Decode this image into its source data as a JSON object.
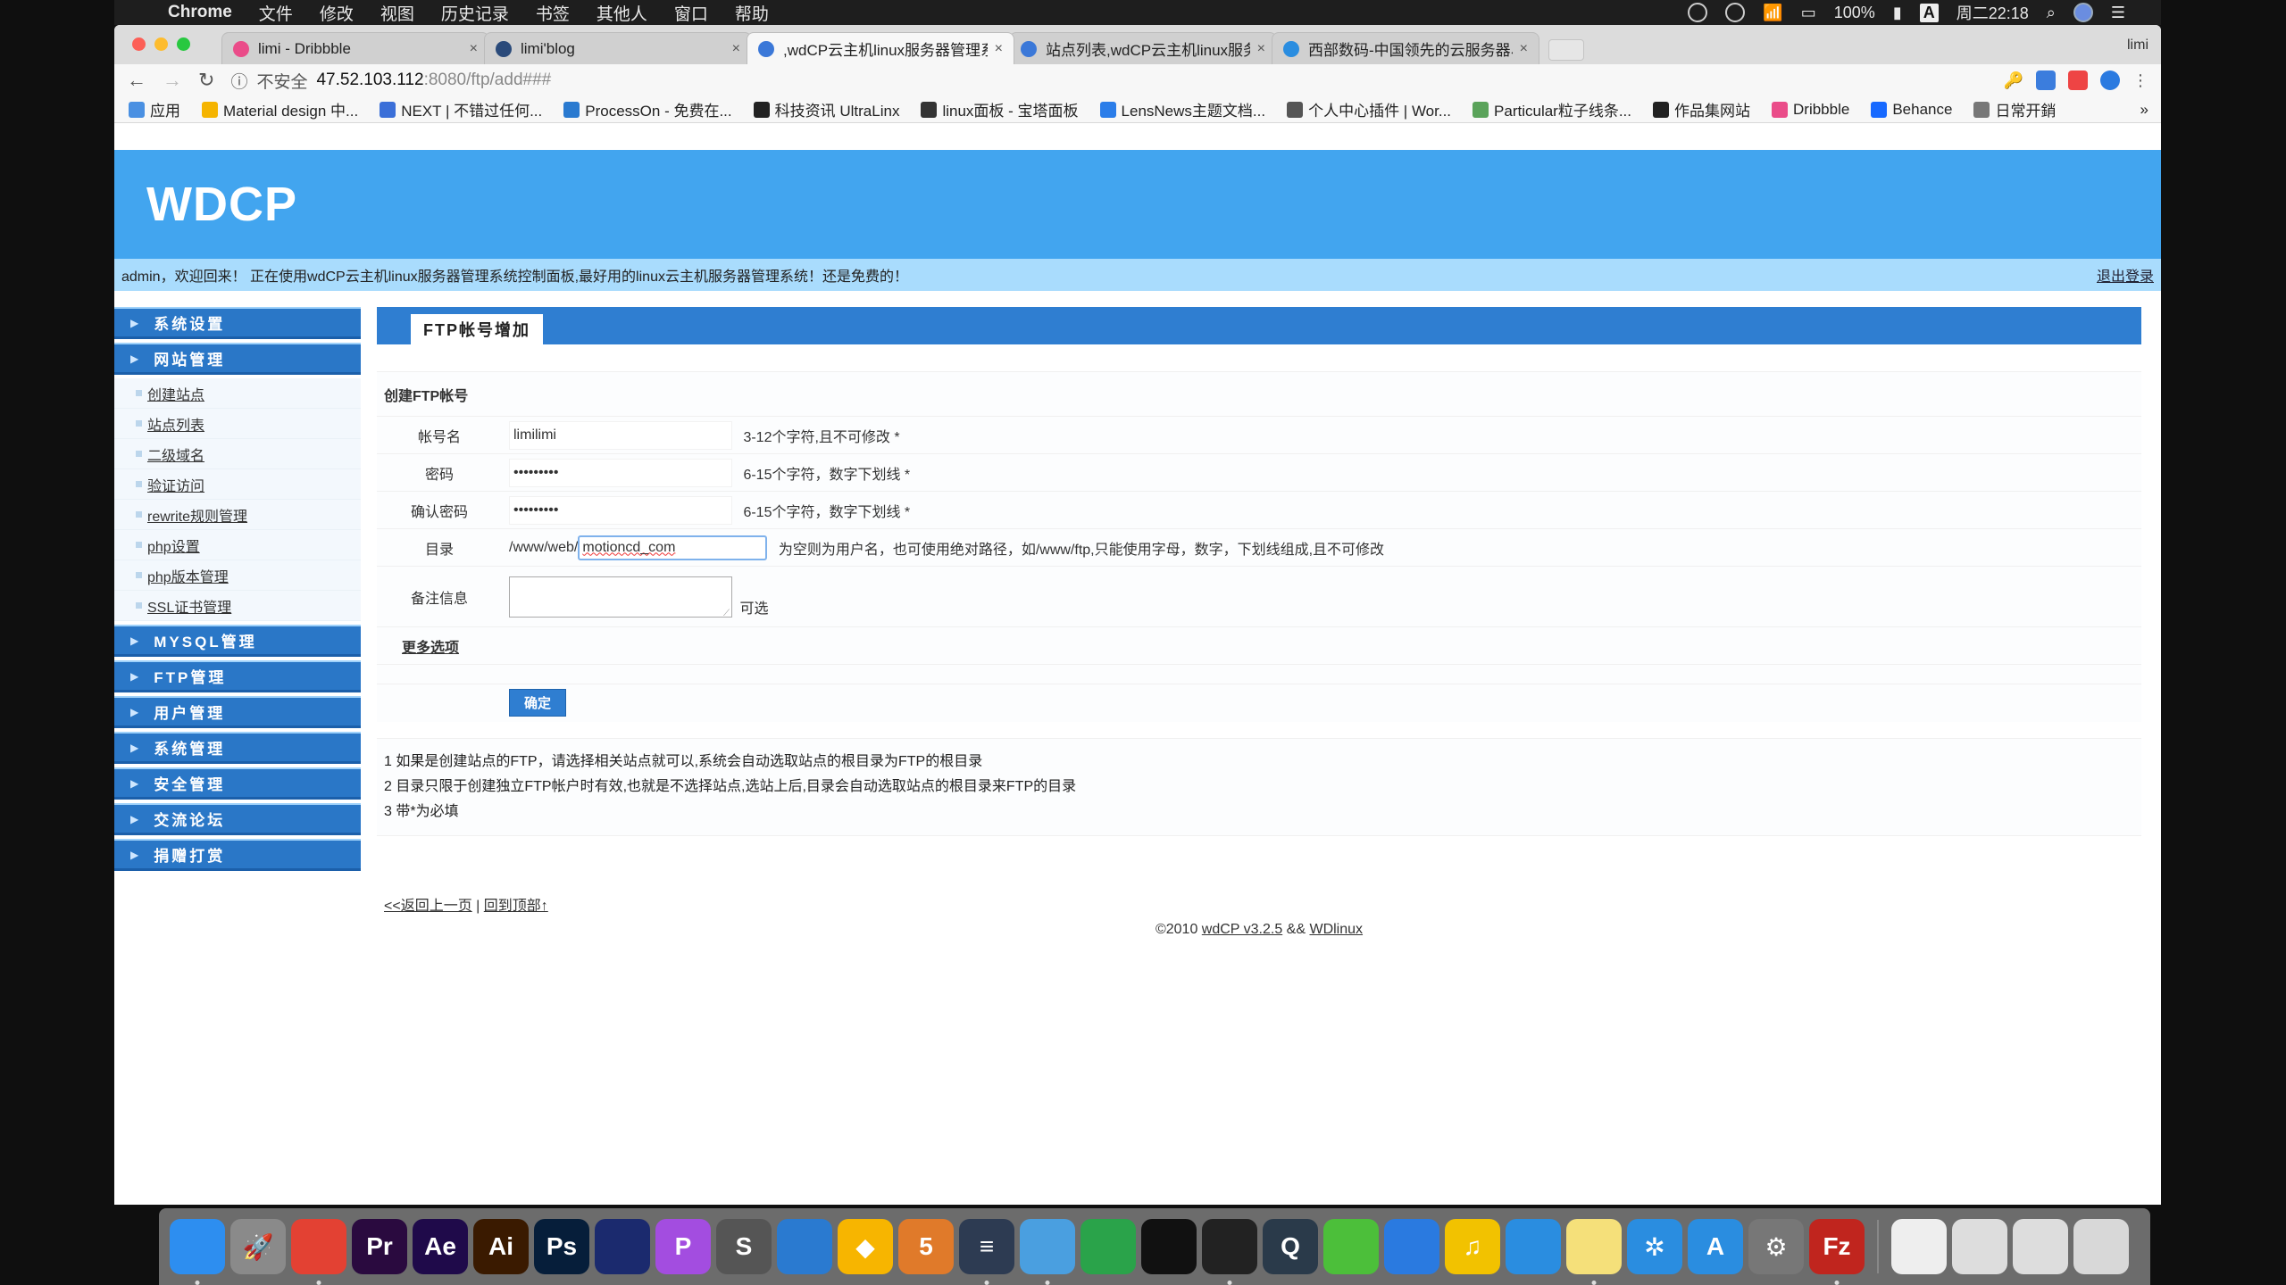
{
  "menubar": {
    "apple": "",
    "app_name": "Chrome",
    "menus": [
      "文件",
      "修改",
      "视图",
      "历史记录",
      "书签",
      "其他人",
      "窗口",
      "帮助"
    ],
    "battery": "100%",
    "input_method": "A",
    "clock": "周二22:18"
  },
  "browser": {
    "tabs": [
      {
        "title": "limi - Dribbble",
        "favicon_color": "#ea4c89",
        "active": false
      },
      {
        "title": "limi'blog",
        "favicon_color": "#2a4a7a",
        "active": false
      },
      {
        "title": ",wdCP云主机linux服务器管理系",
        "favicon_color": "#3b78d8",
        "active": true
      },
      {
        "title": "站点列表,wdCP云主机linux服务",
        "favicon_color": "#3b78d8",
        "active": false
      },
      {
        "title": "西部数码-中国领先的云服务器、",
        "favicon_color": "#2a8de0",
        "active": false
      }
    ],
    "profile_name": "limi",
    "close_glyph": "×",
    "address": {
      "security_label": "不安全",
      "host": "47.52.103.112",
      "path": ":8080/ftp/add###"
    },
    "bookmarks": [
      {
        "label": "应用",
        "color": "#4a90e2"
      },
      {
        "label": "Material design 中...",
        "color": "#f5b400"
      },
      {
        "label": "NEXT | 不错过任何...",
        "color": "#3b6fd8"
      },
      {
        "label": "ProcessOn - 免费在...",
        "color": "#2a7ad0"
      },
      {
        "label": "科技资讯 UltraLinx",
        "color": "#222222"
      },
      {
        "label": "linux面板 - 宝塔面板",
        "color": "#333333"
      },
      {
        "label": "LensNews主题文档...",
        "color": "#2b7de9"
      },
      {
        "label": "个人中心插件 | Wor...",
        "color": "#555555"
      },
      {
        "label": "Particular粒子线条...",
        "color": "#5aa35a"
      },
      {
        "label": "作品集网站",
        "color": "#222222"
      },
      {
        "label": "Dribbble",
        "color": "#ea4c89"
      },
      {
        "label": "Behance",
        "color": "#1769ff"
      },
      {
        "label": "日常开銷",
        "color": "#777777"
      }
    ],
    "more_bookmarks": "»"
  },
  "site": {
    "logo": "WDCP",
    "welcome": "admin，欢迎回来！ 正在使用wdCP云主机linux服务器管理系统控制面板,最好用的linux云主机服务器管理系统！还是免费的！",
    "logout": "退出登录",
    "brand_color": "#42a5ef",
    "nav_color": "#2a77c7"
  },
  "sidebar": {
    "sections": [
      {
        "label": "系统设置",
        "items": []
      },
      {
        "label": "网站管理",
        "items": [
          "创建站点",
          "站点列表",
          "二级域名",
          "验证访问",
          "rewrite规则管理",
          "php设置",
          "php版本管理",
          "SSL证书管理"
        ]
      },
      {
        "label": "MYSQL管理",
        "items": []
      },
      {
        "label": "FTP管理",
        "items": []
      },
      {
        "label": "用户管理",
        "items": []
      },
      {
        "label": "系统管理",
        "items": []
      },
      {
        "label": "安全管理",
        "items": []
      },
      {
        "label": "交流论坛",
        "items": []
      },
      {
        "label": "捐赠打赏",
        "items": []
      }
    ]
  },
  "content": {
    "panel_title": "FTP帐号增加",
    "form_caption": "创建FTP帐号",
    "fields": {
      "username": {
        "label": "帐号名",
        "value": "limilimi",
        "hint": "3-12个字符,且不可修改 *"
      },
      "password": {
        "label": "密码",
        "value": "•••••••••",
        "hint": "6-15个字符，数字下划线 *"
      },
      "confirm_password": {
        "label": "确认密码",
        "value": "•••••••••",
        "hint": "6-15个字符，数字下划线 *"
      },
      "directory": {
        "label": "目录",
        "prefix": "/www/web/",
        "value": "motioncd_com",
        "hint": "为空则为用户名，也可使用绝对路径，如/www/ftp,只能使用字母，数字，下划线组成,且不可修改"
      },
      "remark": {
        "label": "备注信息",
        "value": "",
        "hint": "可选"
      }
    },
    "more_options": "更多选项",
    "submit": "确定",
    "notes": [
      "1 如果是创建站点的FTP，请选择相关站点就可以,系统会自动选取站点的根目录为FTP的根目录",
      "2 目录只限于创建独立FTP帐户时有效,也就是不选择站点,选站上后,目录会自动选取站点的根目录来FTP的目录",
      "3 带*为必填"
    ],
    "back_link": "<<返回上一页",
    "separator": "|",
    "top_link": "回到顶部↑",
    "copyright_prefix": "©2010",
    "copyright_link1": "wdCP v3.2.5",
    "copyright_mid": "&&",
    "copyright_link2": "WDlinux"
  },
  "dock": {
    "items": [
      {
        "name": "finder",
        "label": "",
        "color": "#2d8ef0",
        "running": true
      },
      {
        "name": "launchpad",
        "label": "🚀",
        "color": "#8a8a8a",
        "running": false
      },
      {
        "name": "chrome",
        "label": "",
        "color": "#e34133",
        "running": true
      },
      {
        "name": "premiere",
        "label": "Pr",
        "color": "#2a0a3f",
        "running": false
      },
      {
        "name": "after-effects",
        "label": "Ae",
        "color": "#1f0a4a",
        "running": false
      },
      {
        "name": "illustrator",
        "label": "Ai",
        "color": "#3a1a00",
        "running": false
      },
      {
        "name": "photoshop",
        "label": "Ps",
        "color": "#061e3a",
        "running": false
      },
      {
        "name": "cinema4d",
        "label": "",
        "color": "#1b2a6e",
        "running": false
      },
      {
        "name": "pockity",
        "label": "P",
        "color": "#a34de0",
        "running": false
      },
      {
        "name": "sublime",
        "label": "S",
        "color": "#555555",
        "running": false
      },
      {
        "name": "sketchbook",
        "label": "",
        "color": "#2a7ad0",
        "running": false
      },
      {
        "name": "sketch",
        "label": "◆",
        "color": "#f7b500",
        "running": false
      },
      {
        "name": "hype",
        "label": "5",
        "color": "#e07a2a",
        "running": false
      },
      {
        "name": "notefile",
        "label": "≡",
        "color": "#2d3b52",
        "running": true
      },
      {
        "name": "maps",
        "label": "",
        "color": "#4a9fe0",
        "running": true
      },
      {
        "name": "evernote",
        "label": "",
        "color": "#2aa34a",
        "running": false
      },
      {
        "name": "qq",
        "label": "",
        "color": "#111111",
        "running": false
      },
      {
        "name": "obs",
        "label": "",
        "color": "#222222",
        "running": true
      },
      {
        "name": "quicktime",
        "label": "Q",
        "color": "#2a3a4a",
        "running": false
      },
      {
        "name": "wechat",
        "label": "",
        "color": "#4cbf3a",
        "running": false
      },
      {
        "name": "browser",
        "label": "",
        "color": "#2a7ae0",
        "running": false
      },
      {
        "name": "qq-music",
        "label": "♫",
        "color": "#f2c200",
        "running": false
      },
      {
        "name": "keynote",
        "label": "",
        "color": "#2a8de0",
        "running": false
      },
      {
        "name": "notes",
        "label": "",
        "color": "#f5e07a",
        "running": true
      },
      {
        "name": "xmind",
        "label": "✲",
        "color": "#2a8de0",
        "running": false
      },
      {
        "name": "app-store",
        "label": "A",
        "color": "#2a8de0",
        "running": false
      },
      {
        "name": "system-preferences",
        "label": "⚙",
        "color": "#777777",
        "running": false
      },
      {
        "name": "filezilla",
        "label": "Fz",
        "color": "#c0251e",
        "running": true
      },
      {
        "name": "downloads",
        "label": "",
        "color": "#eeeeee",
        "running": false
      },
      {
        "name": "screenshot-1",
        "label": "",
        "color": "#dddddd",
        "running": false
      },
      {
        "name": "screenshot-2",
        "label": "",
        "color": "#dddddd",
        "running": false
      },
      {
        "name": "trash",
        "label": "",
        "color": "#d8d8d8",
        "running": false
      }
    ]
  }
}
